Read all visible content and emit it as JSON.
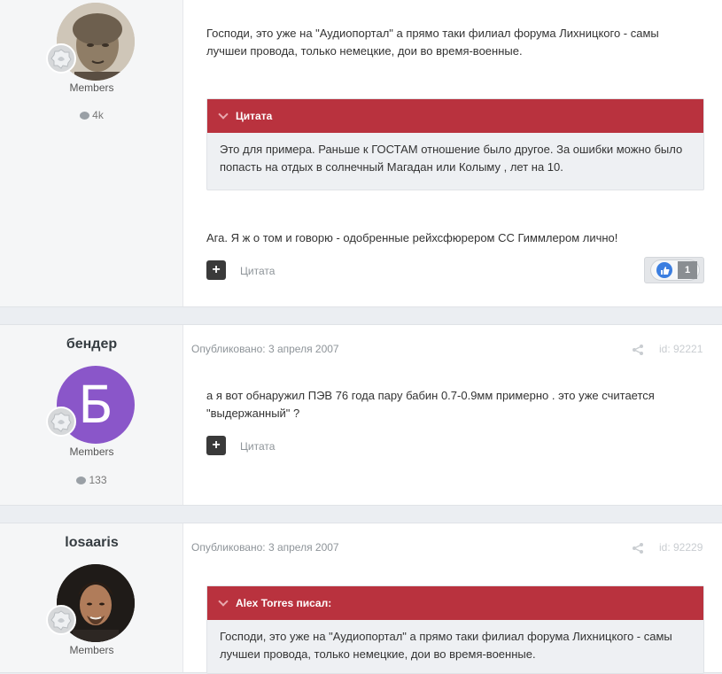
{
  "post1": {
    "group": "Members",
    "count": "4k",
    "text": "Господи, это уже на \"Аудиопортал\" а прямо таки филиал форума Лихницкого - самы лучшеи провода, только немецкие, дои во время-военные.",
    "quote_title": "Цитата",
    "quote_text": "Это для примера. Раньше к ГОСТАМ отношение было другое. За ошибки можно было попасть на отдых в солнечный Магадан или Колыму , лет на 10.",
    "reply_text": "Ага. Я ж о том и говорю - одобренные рейхсфюрером СС Гиммлером лично!",
    "quote_button": "Цитата",
    "reaction_count": "1"
  },
  "post2": {
    "author": "бендер",
    "avatar_letter": "Б",
    "avatar_color": "#8a56c9",
    "group": "Members",
    "count": "133",
    "meta": "Опубликовано: 3 апреля 2007",
    "post_id": "id: 92221",
    "text": "а я вот обнаружил ПЭВ 76 года пару бабин 0.7-0.9мм примерно . это уже считается \"выдержанный\" ?",
    "quote_button": "Цитата"
  },
  "post3": {
    "author": "losaaris",
    "group": "Members",
    "meta": "Опубликовано: 3 апреля 2007",
    "post_id": "id: 92229",
    "quote_title": "Alex Torres писал:",
    "quote_text": "Господи, это уже на \"Аудиопортал\" а прямо таки филиал форума Лихницкого - самы лучшеи провода, только немецкие, дои во время-военные."
  },
  "colors": {
    "quote_header": "#b9323e",
    "quote_body": "#eef0f3",
    "page_bg": "#ebeef2"
  }
}
